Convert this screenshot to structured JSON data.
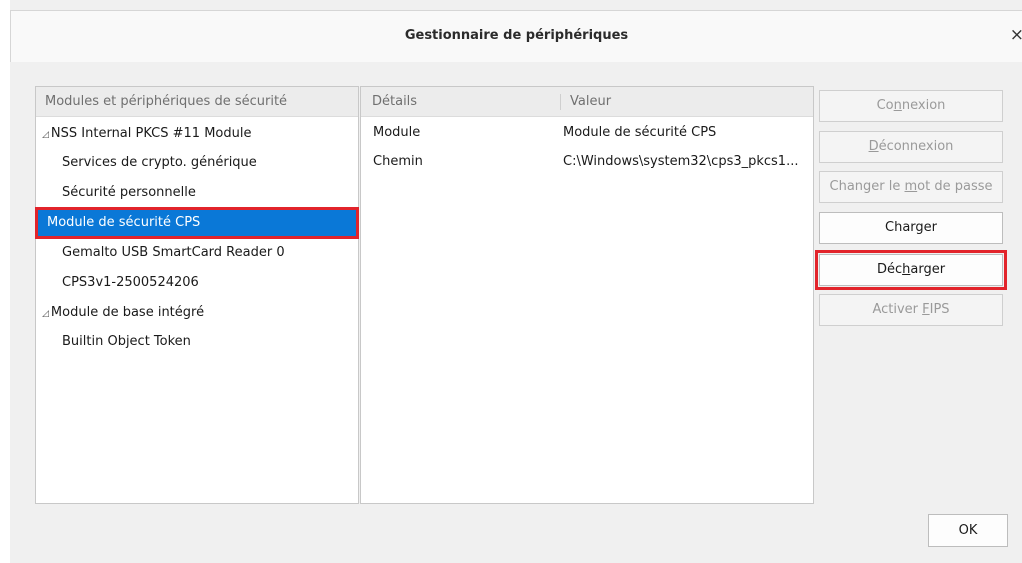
{
  "window": {
    "title": "Gestionnaire de périphériques",
    "close_glyph": "×"
  },
  "modules_panel": {
    "header": "Modules et périphériques de sécurité",
    "items": [
      {
        "label": "NSS Internal PKCS #11 Module",
        "level": 0,
        "expanded": true
      },
      {
        "label": "Services de crypto. générique",
        "level": 1
      },
      {
        "label": "Sécurité personnelle",
        "level": 1
      },
      {
        "label": "Module de sécurité CPS",
        "level": 0,
        "selected": true
      },
      {
        "label": "Gemalto USB SmartCard Reader 0",
        "level": 1
      },
      {
        "label": "CPS3v1-2500524206",
        "level": 1
      },
      {
        "label": "Module de base intégré",
        "level": 0,
        "expanded": true
      },
      {
        "label": "Builtin Object Token",
        "level": 1
      }
    ]
  },
  "details_panel": {
    "col_details": "Détails",
    "col_value": "Valeur",
    "rows": [
      {
        "key": "Module",
        "value": "Module de sécurité CPS"
      },
      {
        "key": "Chemin",
        "value": "C:\\Windows\\system32\\cps3_pkcs1..."
      }
    ]
  },
  "buttons": {
    "connexion": {
      "pre": "Co",
      "accel": "n",
      "post": "nexion",
      "enabled": false
    },
    "deconnexion": {
      "pre": "",
      "accel": "D",
      "post": "éconnexion",
      "enabled": false
    },
    "changer_mdp": {
      "pre": "Changer le ",
      "accel": "m",
      "post": "ot de passe",
      "enabled": false
    },
    "charger": {
      "pre": "Charger",
      "accel": "",
      "post": "",
      "enabled": true
    },
    "decharger": {
      "pre": "Déc",
      "accel": "h",
      "post": "arger",
      "enabled": true
    },
    "activer_fips": {
      "pre": "Activer ",
      "accel": "F",
      "post": "IPS",
      "enabled": false
    },
    "ok": "OK"
  },
  "colors": {
    "selection": "#0a78d7",
    "highlight_frame": "#e2242b"
  },
  "icons": {
    "twisty": "expanded-triangle-icon",
    "close": "close-icon"
  }
}
